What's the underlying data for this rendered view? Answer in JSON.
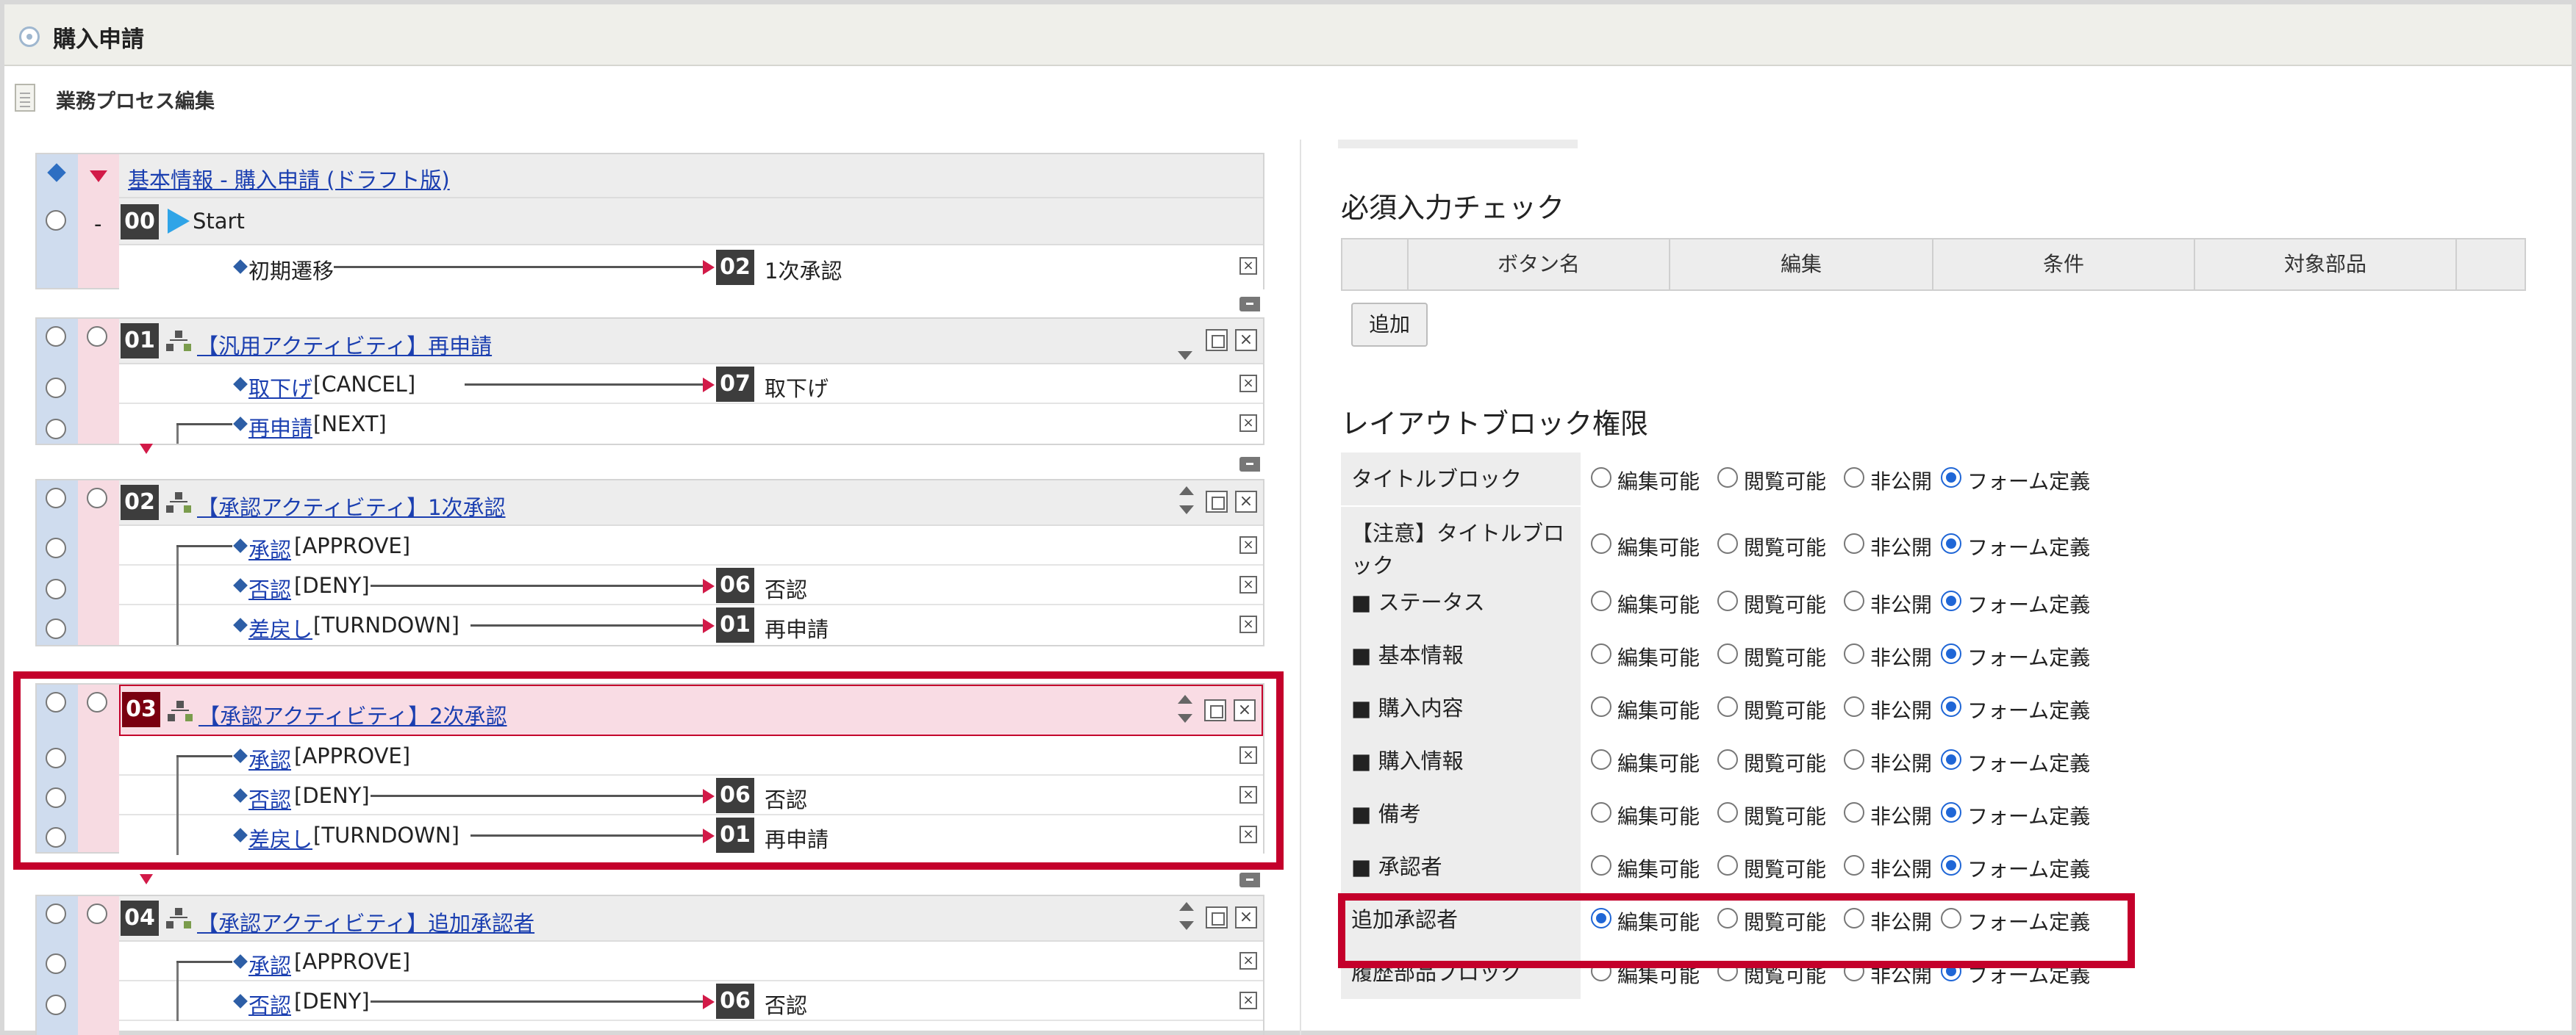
{
  "window": {
    "title": "購入申請"
  },
  "section_label": "業務プロセス編集",
  "process": {
    "header_link": "基本情報 - 購入申請 (ドラフト版)",
    "start": {
      "number": "00",
      "minus": "-",
      "label": "Start"
    },
    "initial_transition": {
      "label": "初期遷移",
      "dest_num": "02",
      "dest_label": "1次承認"
    },
    "activities": [
      {
        "number": "01",
        "title": "【汎用アクティビティ】再申請",
        "transitions": [
          {
            "link": "取下げ",
            "code": "[CANCEL]",
            "dest_num": "07",
            "dest_label": "取下げ"
          },
          {
            "link": "再申請",
            "code": "[NEXT]",
            "dest_num": "",
            "dest_label": ""
          }
        ]
      },
      {
        "number": "02",
        "title": "【承認アクティビティ】1次承認",
        "transitions": [
          {
            "link": "承認",
            "code": "[APPROVE]",
            "dest_num": "",
            "dest_label": ""
          },
          {
            "link": "否認",
            "code": "[DENY]",
            "dest_num": "06",
            "dest_label": "否認"
          },
          {
            "link": "差戻し",
            "code": "[TURNDOWN]",
            "dest_num": "01",
            "dest_label": "再申請"
          }
        ]
      },
      {
        "number": "03",
        "title": "【承認アクティビティ】2次承認",
        "transitions": [
          {
            "link": "承認",
            "code": "[APPROVE]",
            "dest_num": "",
            "dest_label": ""
          },
          {
            "link": "否認",
            "code": "[DENY]",
            "dest_num": "06",
            "dest_label": "否認"
          },
          {
            "link": "差戻し",
            "code": "[TURNDOWN]",
            "dest_num": "01",
            "dest_label": "再申請"
          }
        ]
      },
      {
        "number": "04",
        "title": "【承認アクティビティ】追加承認者",
        "transitions": [
          {
            "link": "承認",
            "code": "[APPROVE]",
            "dest_num": "",
            "dest_label": ""
          },
          {
            "link": "否認",
            "code": "[DENY]",
            "dest_num": "06",
            "dest_label": "否認"
          }
        ]
      }
    ]
  },
  "required_check": {
    "title": "必須入力チェック",
    "columns": [
      "ボタン名",
      "編集",
      "条件",
      "対象部品"
    ],
    "add_button": "追加"
  },
  "layout_permissions": {
    "title": "レイアウトブロック権限",
    "options": [
      "編集可能",
      "閲覧可能",
      "非公開",
      "フォーム定義"
    ],
    "rows": [
      {
        "label": "タイトルブロック",
        "selected": 3
      },
      {
        "label": "【注意】タイトルブロック",
        "selected": 3
      },
      {
        "label": "■ ステータス",
        "selected": 3
      },
      {
        "label": "■ 基本情報",
        "selected": 3
      },
      {
        "label": "■ 購入内容",
        "selected": 3
      },
      {
        "label": "■ 購入情報",
        "selected": 3
      },
      {
        "label": "■ 備考",
        "selected": 3
      },
      {
        "label": "■ 承認者",
        "selected": 3
      },
      {
        "label": "追加承認者",
        "selected": 0
      },
      {
        "label": "履歴部品ブロック",
        "selected": 3
      }
    ]
  },
  "colors": {
    "accent_red": "#c4002b",
    "link_blue": "#1b3fb0",
    "radio_blue": "#1f66d6"
  }
}
